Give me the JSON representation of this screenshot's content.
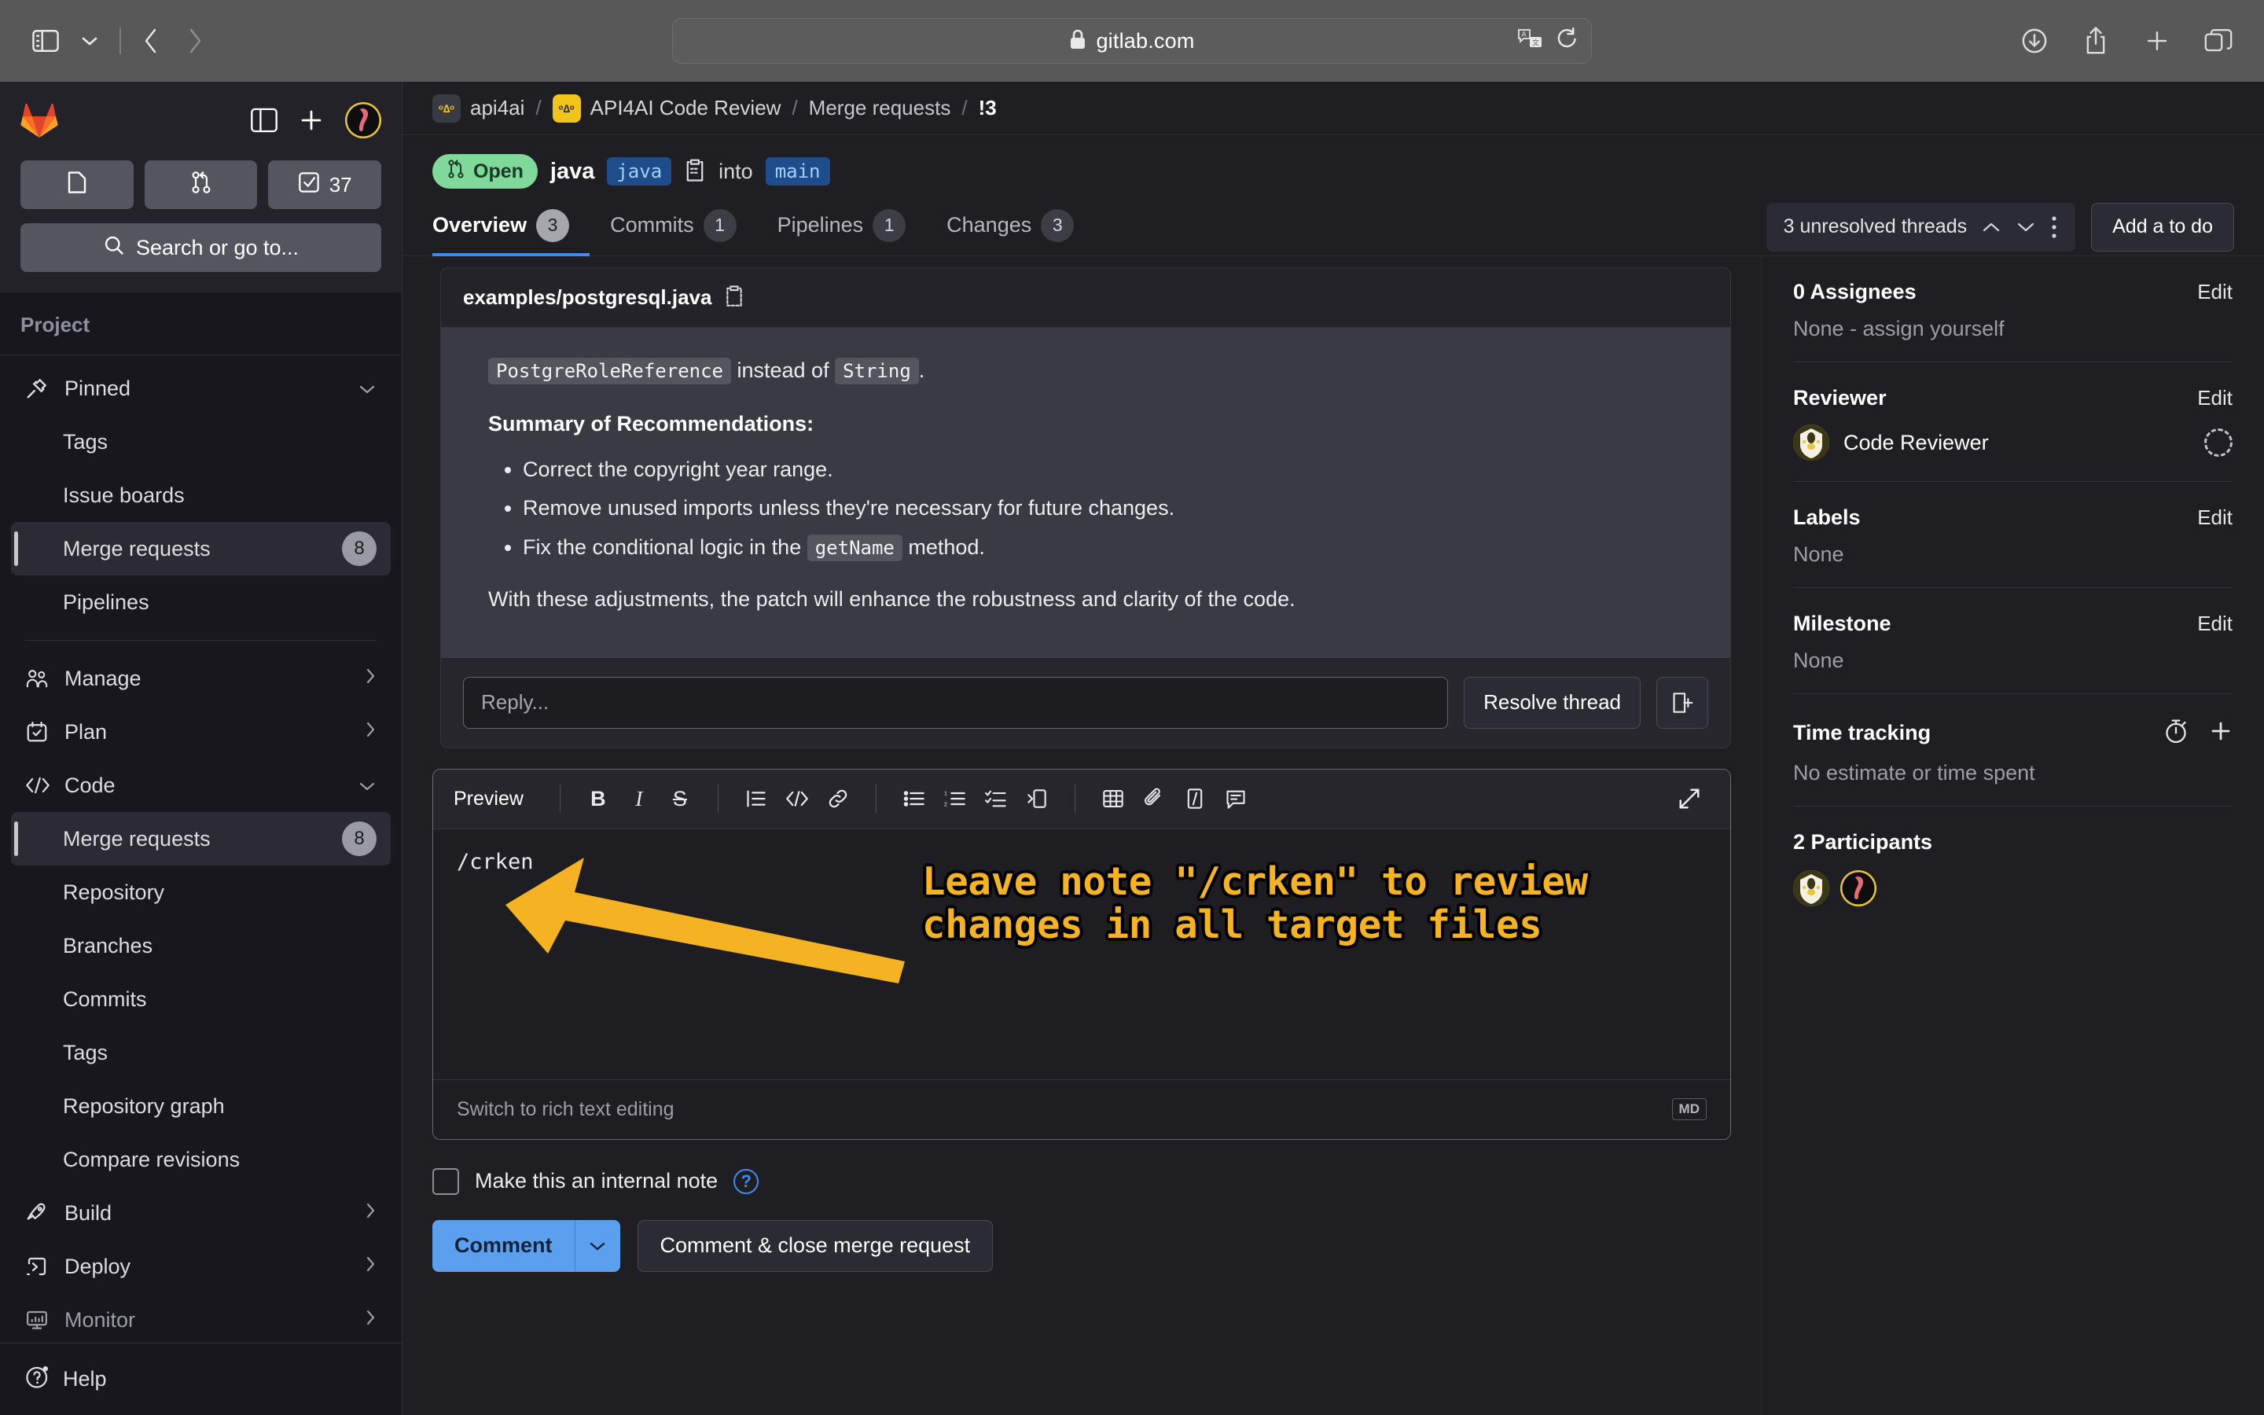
{
  "browser": {
    "url": "gitlab.com",
    "lock_icon": "lock-icon",
    "translate_icon": "translate-icon",
    "reload_icon": "reload-icon",
    "sidebar_toggle_icon": "sidebar-toggle-icon",
    "tab_overview_icon": "chevron-down-icon",
    "back_icon": "back-arrow-icon",
    "forward_icon": "forward-arrow-icon",
    "downloads_icon": "downloads-icon",
    "share_icon": "share-icon",
    "new_tab_icon": "plus-icon",
    "tabs_icon": "tab-overview-icon"
  },
  "sidebar": {
    "logo": "gitlab-logo",
    "collapse_icon": "panel-collapse-icon",
    "create_new_icon": "plus-icon",
    "user_avatar": "user-avatar",
    "quick_buttons": [
      {
        "name": "issues",
        "icon": "issue-icon",
        "count": ""
      },
      {
        "name": "merge-requests",
        "icon": "merge-request-icon",
        "count": ""
      },
      {
        "name": "todos",
        "icon": "todo-check-icon",
        "count": "37"
      }
    ],
    "search_placeholder": "Search or go to...",
    "section_label": "Project",
    "items": [
      {
        "label": "Pinned",
        "icon": "pin-icon",
        "badge": "",
        "chevron": "down",
        "type": "group",
        "active": false,
        "dim": false
      },
      {
        "label": "Tags",
        "icon": "",
        "badge": "",
        "chevron": "",
        "type": "sub",
        "active": false,
        "dim": false
      },
      {
        "label": "Issue boards",
        "icon": "",
        "badge": "",
        "chevron": "",
        "type": "sub",
        "active": false,
        "dim": false
      },
      {
        "label": "Merge requests",
        "icon": "",
        "badge": "8",
        "chevron": "",
        "type": "sub",
        "active": true,
        "dim": false
      },
      {
        "label": "Pipelines",
        "icon": "",
        "badge": "",
        "chevron": "",
        "type": "sub",
        "active": false,
        "dim": false
      },
      {
        "label": "Manage",
        "icon": "users-icon",
        "badge": "",
        "chevron": "right",
        "type": "group",
        "active": false,
        "dim": false
      },
      {
        "label": "Plan",
        "icon": "calendar-icon",
        "badge": "",
        "chevron": "right",
        "type": "group",
        "active": false,
        "dim": false
      },
      {
        "label": "Code",
        "icon": "code-brackets-icon",
        "badge": "",
        "chevron": "down",
        "type": "group",
        "active": false,
        "dim": false
      },
      {
        "label": "Merge requests",
        "icon": "",
        "badge": "8",
        "chevron": "",
        "type": "sub",
        "active": true,
        "dim": false
      },
      {
        "label": "Repository",
        "icon": "",
        "badge": "",
        "chevron": "",
        "type": "sub",
        "active": false,
        "dim": false
      },
      {
        "label": "Branches",
        "icon": "",
        "badge": "",
        "chevron": "",
        "type": "sub",
        "active": false,
        "dim": false
      },
      {
        "label": "Commits",
        "icon": "",
        "badge": "",
        "chevron": "",
        "type": "sub",
        "active": false,
        "dim": false
      },
      {
        "label": "Tags",
        "icon": "",
        "badge": "",
        "chevron": "",
        "type": "sub",
        "active": false,
        "dim": false
      },
      {
        "label": "Repository graph",
        "icon": "",
        "badge": "",
        "chevron": "",
        "type": "sub",
        "active": false,
        "dim": false
      },
      {
        "label": "Compare revisions",
        "icon": "",
        "badge": "",
        "chevron": "",
        "type": "sub",
        "active": false,
        "dim": false
      },
      {
        "label": "Build",
        "icon": "rocket-icon",
        "badge": "",
        "chevron": "right",
        "type": "group",
        "active": false,
        "dim": false
      },
      {
        "label": "Deploy",
        "icon": "deploy-icon",
        "badge": "",
        "chevron": "right",
        "type": "group",
        "active": false,
        "dim": false
      },
      {
        "label": "Monitor",
        "icon": "monitor-icon",
        "badge": "",
        "chevron": "right",
        "type": "group",
        "active": false,
        "dim": true
      }
    ],
    "help_label": "Help",
    "help_icon": "help-question-icon"
  },
  "breadcrumb": {
    "group": "api4ai",
    "project": "API4AI Code Review",
    "section": "Merge requests",
    "item": "!3"
  },
  "mr": {
    "status": "Open",
    "status_icon": "merge-request-icon",
    "source_branch": "java",
    "source_branch_chip": "java",
    "copy_icon": "copy-icon",
    "into": "into",
    "target_branch": "main"
  },
  "tabs": [
    {
      "label": "Overview",
      "count": "3",
      "active": true
    },
    {
      "label": "Commits",
      "count": "1",
      "active": false
    },
    {
      "label": "Pipelines",
      "count": "1",
      "active": false
    },
    {
      "label": "Changes",
      "count": "3",
      "active": false
    }
  ],
  "threads_control": {
    "label": "3 unresolved threads",
    "up_icon": "chevron-up-icon",
    "down_icon": "chevron-down-icon",
    "more_icon": "ellipsis-vertical-icon"
  },
  "todo_button": "Add a to do",
  "thread": {
    "file": "examples/postgresql.java",
    "copy_icon": "copy-icon",
    "line1_prefix": "",
    "line1_code1": "PostgreRoleReference",
    "line1_mid": " instead of ",
    "line1_code2": "String",
    "line1_suffix": ".",
    "summary_heading": "Summary of Recommendations:",
    "bullets": [
      {
        "pre": "Correct the copyright year range.",
        "code": "",
        "post": ""
      },
      {
        "pre": "Remove unused imports unless they're necessary for future changes.",
        "code": "",
        "post": ""
      },
      {
        "pre": "Fix the conditional logic in the ",
        "code": "getName",
        "post": " method."
      }
    ],
    "closing": "With these adjustments, the patch will enhance the robustness and clarity of the code.",
    "reply_placeholder": "Reply...",
    "resolve_label": "Resolve thread",
    "resolve_note_icon": "resolve-note-icon"
  },
  "editor": {
    "preview_label": "Preview",
    "toolbar_icons": [
      "bold-icon",
      "italic-icon",
      "strikethrough-icon",
      "blockquote-icon",
      "code-icon",
      "link-icon",
      "bullet-list-icon",
      "numbered-list-icon",
      "task-list-icon",
      "indent-icon",
      "table-icon",
      "attachment-icon",
      "video-icon",
      "comment-template-icon"
    ],
    "expand_icon": "expand-icon",
    "value": "/crken",
    "footer_label": "Switch to rich text editing",
    "markdown_badge": "MD"
  },
  "annotation": {
    "text": "Leave note \"/crken\" to review\nchanges in all target files",
    "arrow": "annotation-arrow",
    "color": "#f5b324"
  },
  "comment_form": {
    "internal_note_label": "Make this an internal note",
    "help_icon": "help-question-icon",
    "comment_label": "Comment",
    "comment_caret_icon": "chevron-down-icon",
    "close_mr_label": "Comment & close merge request"
  },
  "right_panel": {
    "assignees": {
      "title": "0 Assignees",
      "edit": "Edit",
      "value": "None - assign yourself"
    },
    "reviewer": {
      "title": "Reviewer",
      "edit": "Edit",
      "name": "Code Reviewer",
      "status_icon": "pending-dashed-circle-icon"
    },
    "labels": {
      "title": "Labels",
      "edit": "Edit",
      "value": "None"
    },
    "milestone": {
      "title": "Milestone",
      "edit": "Edit",
      "value": "None"
    },
    "time_tracking": {
      "title": "Time tracking",
      "value": "No estimate or time spent",
      "timer_icon": "stopwatch-icon",
      "add_icon": "plus-icon"
    },
    "participants": {
      "title": "2 Participants",
      "avatars": [
        "code-reviewer-avatar",
        "user-avatar"
      ]
    }
  }
}
